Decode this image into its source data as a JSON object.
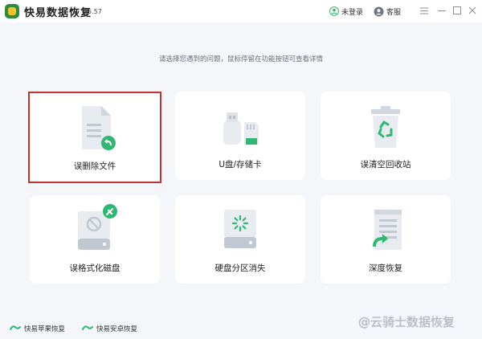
{
  "app": {
    "title": "快易数据恢复",
    "version": "5.57"
  },
  "header": {
    "user_label": "未登录",
    "service_label": "客服"
  },
  "hint": "请选择您遇到的问题，鼠标停留在功能按钮可查看详情",
  "cards": [
    {
      "label": "误删除文件",
      "icon": "document-restore-icon"
    },
    {
      "label": "U盘/存储卡",
      "icon": "usb-sdcard-icon"
    },
    {
      "label": "误清空回收站",
      "icon": "recycle-bin-icon"
    },
    {
      "label": "误格式化磁盘",
      "icon": "format-disk-icon"
    },
    {
      "label": "硬盘分区消失",
      "icon": "disk-partition-icon"
    },
    {
      "label": "深度恢复",
      "icon": "deep-recovery-icon"
    }
  ],
  "footer": {
    "apple_label": "快易苹果恢复",
    "android_label": "快易安卓恢复"
  },
  "watermark": "@云骑士数据恢复",
  "colors": {
    "accent": "#2eb872",
    "selected_border": "#c0332f"
  }
}
